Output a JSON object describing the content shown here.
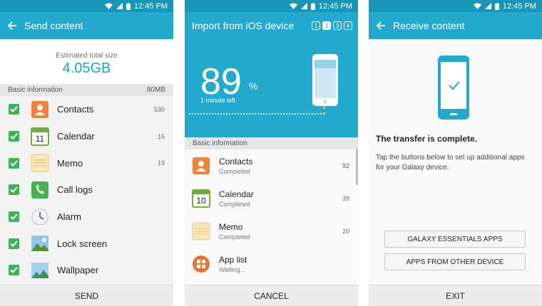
{
  "status_time": "12:45 PM",
  "send_screen": {
    "title": "Send content",
    "estimated_label": "Estimated total size",
    "estimated_value": "4.05GB",
    "section_label": "Basic information",
    "section_size": "80MB",
    "items": [
      {
        "label": "Contacts",
        "count": "530",
        "icon": "contacts-icon"
      },
      {
        "label": "Calendar",
        "count": "15",
        "icon": "calendar-icon"
      },
      {
        "label": "Memo",
        "count": "19",
        "icon": "memo-icon"
      },
      {
        "label": "Call logs",
        "count": "",
        "icon": "call-logs-icon"
      },
      {
        "label": "Alarm",
        "count": "",
        "icon": "alarm-icon"
      },
      {
        "label": "Lock screen",
        "count": "",
        "icon": "lock-screen-icon"
      },
      {
        "label": "Wallpaper",
        "count": "",
        "icon": "wallpaper-icon"
      }
    ],
    "calendar_day": "11",
    "send_label": "SEND"
  },
  "import_screen": {
    "title": "Import from iOS device",
    "steps": [
      "1",
      "2",
      "3",
      "4"
    ],
    "active_step": 2,
    "percent": "89",
    "percent_sign": "%",
    "time_left": "1 minute left",
    "progress": 0.89,
    "section_label": "Basic information",
    "items": [
      {
        "label": "Contacts",
        "status": "Completed",
        "count": "92",
        "icon": "contacts-icon"
      },
      {
        "label": "Calendar",
        "status": "Completed",
        "count": "39",
        "icon": "calendar-icon"
      },
      {
        "label": "Memo",
        "status": "Completed",
        "count": "20",
        "icon": "memo-icon"
      },
      {
        "label": "App list",
        "status": "Waiting...",
        "count": "",
        "icon": "app-list-icon"
      }
    ],
    "calendar_day": "10",
    "cancel_label": "CANCEL"
  },
  "receive_screen": {
    "title": "Receive content",
    "complete_text": "The transfer is complete.",
    "description": "Tap the buttons below to set up additional apps for your Galaxy device.",
    "essentials_button": "GALAXY ESSENTIALS APPS",
    "other_device_button": "APPS FROM OTHER DEVICE",
    "exit_label": "EXIT"
  },
  "colors": {
    "header": "#22a9cd",
    "statusbar": "#1896b8",
    "accent": "#1aa0c6",
    "checkbox": "#3fb05a",
    "orange": "#f0833a"
  }
}
